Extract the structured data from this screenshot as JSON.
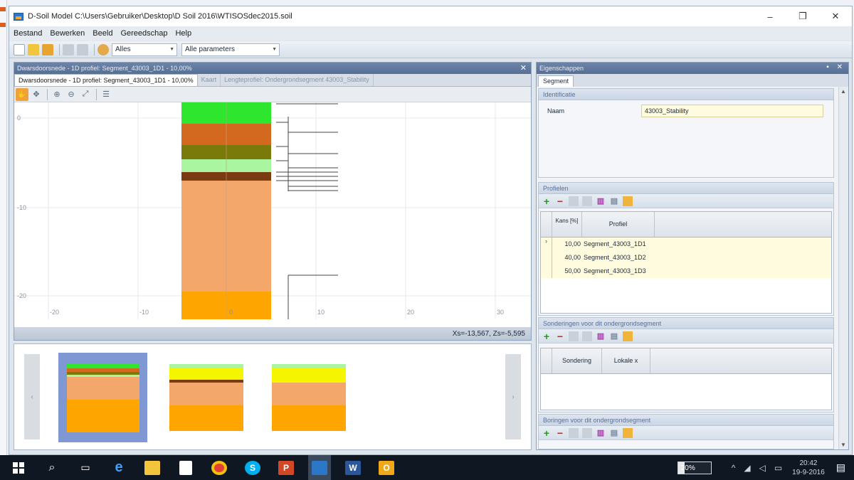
{
  "window": {
    "title": "D-Soil Model  C:\\Users\\Gebruiker\\Desktop\\D Soil 2016\\WTISOSdec2015.soil"
  },
  "window_controls": {
    "minimize": "–",
    "restore": "❐",
    "close": "✕"
  },
  "menu": [
    "Bestand",
    "Bewerken",
    "Beeld",
    "Gereedschap",
    "Help"
  ],
  "toolbar": {
    "filter_value": "Alles",
    "parameter_value": "Alle parameters"
  },
  "left_panel": {
    "title": "Dwarsdoorsnede - 1D profiel: Segment_43003_1D1 - 10,00%",
    "close": "✕",
    "tabs": [
      "Dwarsdoorsnede - 1D profiel: Segment_43003_1D1 - 10,00%",
      "Kaart",
      "Lengteprofiel: Ondergrondsegment 43003_Stability"
    ],
    "status": "Xs=-13,567, Zs=-5,595"
  },
  "plot": {
    "y_ticks": [
      "0",
      "-10",
      "-20"
    ],
    "x_ticks": [
      "-20",
      "-10",
      "0",
      "10",
      "20",
      "30"
    ],
    "colors": {
      "bright_green": "#2ee62e",
      "brown_orange": "#d2691e",
      "olive": "#7a7a0a",
      "light_green": "#a9f5a0",
      "dark_brown": "#7a3b10",
      "sand": "#f4a76a",
      "orange": "#ffa500",
      "yellow": "#f5f500"
    }
  },
  "thumbnails": {
    "prev": "‹",
    "next": "›"
  },
  "right_panel": {
    "title": "Eigenschappen",
    "header_controls": "▪ ✕",
    "tab": "Segment",
    "identificatie": {
      "header": "Identificatie",
      "label": "Naam",
      "value": "43003_Stability"
    },
    "profielen": {
      "header": "Profielen",
      "columns": [
        "Kans [%]",
        "Profiel"
      ],
      "rows": [
        {
          "kans": "10,00",
          "profiel": "Segment_43003_1D1",
          "marker": "›"
        },
        {
          "kans": "40,00",
          "profiel": "Segment_43003_1D2",
          "marker": ""
        },
        {
          "kans": "50,00",
          "profiel": "Segment_43003_1D3",
          "marker": ""
        }
      ]
    },
    "sonderingen": {
      "header": "Sonderingen voor dit ondergrondsegment",
      "columns": [
        "Sondering",
        "Lokale x"
      ]
    },
    "boringen": {
      "header": "Boringen voor dit ondergrondsegment"
    }
  },
  "taskbar": {
    "battery": "20%",
    "time": "20:42",
    "date": "19-9-2016"
  }
}
